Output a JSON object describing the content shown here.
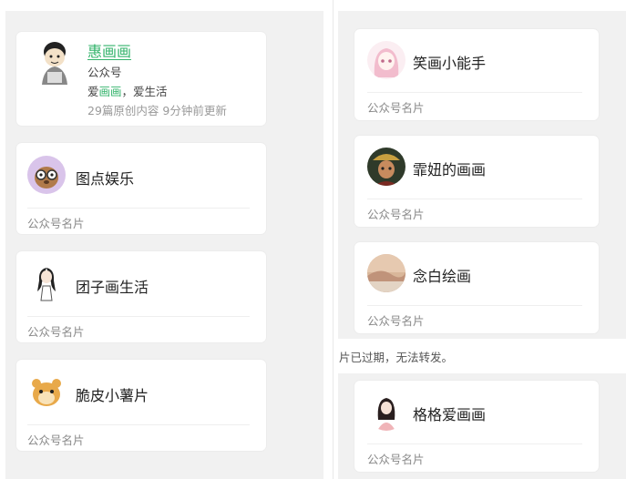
{
  "featured": {
    "name": "惠画画",
    "type": "公众号",
    "slogan_prefix": "爱",
    "slogan_highlight": "画画",
    "slogan_suffix": "，爱生活",
    "stats": "29篇原创内容  9分钟前更新",
    "icon": "cartoon-boy-avatar"
  },
  "left_cards": [
    {
      "name": "图点娱乐",
      "footer": "公众号名片",
      "icon": "otter-glasses-avatar"
    },
    {
      "name": "团子画生活",
      "footer": "公众号名片",
      "icon": "girl-sketch-avatar"
    },
    {
      "name": "脆皮小薯片",
      "footer": "公众号名片",
      "icon": "hamster-avatar"
    }
  ],
  "right_cards": [
    {
      "name": "笑画小能手",
      "footer": "公众号名片",
      "icon": "pink-hair-girl-avatar"
    },
    {
      "name": "霏妞的画画",
      "footer": "公众号名片",
      "icon": "warrior-avatar"
    },
    {
      "name": "念白绘画",
      "footer": "公众号名片",
      "icon": "landscape-avatar"
    },
    {
      "name": "格格爱画画",
      "footer": "公众号名片",
      "icon": "princess-avatar"
    }
  ],
  "expired_notice": "片已过期，无法转发。",
  "colors": {
    "accent": "#33b36b",
    "panel_bg": "#f1f1f1",
    "card_bg": "#ffffff"
  }
}
